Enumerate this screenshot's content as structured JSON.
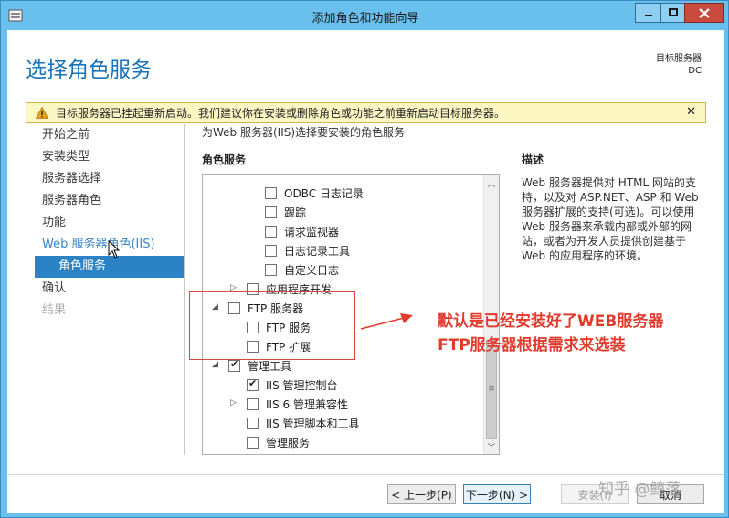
{
  "window": {
    "title": "添加角色和功能向导",
    "min_symbol": "—",
    "max_symbol": "□",
    "close_symbol": "✕"
  },
  "header": {
    "page_title": "选择角色服务",
    "dest_server_label": "目标服务器",
    "dest_server_name": "DC"
  },
  "warning": {
    "text": "目标服务器已挂起重新启动。我们建议你在安装或删除角色或功能之前重新启动目标服务器。",
    "close_symbol": "✕"
  },
  "nav": [
    {
      "label": "开始之前",
      "state": "normal"
    },
    {
      "label": "安装类型",
      "state": "normal"
    },
    {
      "label": "服务器选择",
      "state": "normal"
    },
    {
      "label": "服务器角色",
      "state": "normal"
    },
    {
      "label": "功能",
      "state": "normal"
    },
    {
      "label": "Web 服务器角色(IIS)",
      "state": "link"
    },
    {
      "label": "角色服务",
      "state": "selected"
    },
    {
      "label": "确认",
      "state": "normal"
    },
    {
      "label": "结果",
      "state": "disabled"
    }
  ],
  "content": {
    "description_top": "为Web 服务器(IIS)选择要安装的角色服务",
    "role_services_header": "角色服务",
    "description_header": "描述",
    "description_body": "Web 服务器提供对 HTML 网站的支持，以及对 ASP.NET、ASP 和 Web 服务器扩展的支持(可选)。可以使用 Web 服务器来承载内部或外部的网站，或者为开发人员提供创建基于 Web 的应用程序的环境。"
  },
  "tree": [
    {
      "label": "ODBC 日志记录",
      "checked": false,
      "expander": ""
    },
    {
      "label": "跟踪",
      "checked": false,
      "expander": ""
    },
    {
      "label": "请求监视器",
      "checked": false,
      "expander": ""
    },
    {
      "label": "日志记录工具",
      "checked": false,
      "expander": ""
    },
    {
      "label": "自定义日志",
      "checked": false,
      "expander": ""
    },
    {
      "label": "应用程序开发",
      "checked": false,
      "expander": "▷"
    },
    {
      "label": "FTP 服务器",
      "checked": false,
      "expander": "◢"
    },
    {
      "label": "FTP 服务",
      "checked": false,
      "expander": ""
    },
    {
      "label": "FTP 扩展",
      "checked": false,
      "expander": ""
    },
    {
      "label": "管理工具",
      "checked": true,
      "expander": "◢"
    },
    {
      "label": "IIS 管理控制台",
      "checked": true,
      "expander": ""
    },
    {
      "label": "IIS 6 管理兼容性",
      "checked": false,
      "expander": "▷"
    },
    {
      "label": "IIS 管理脚本和工具",
      "checked": false,
      "expander": ""
    },
    {
      "label": "管理服务",
      "checked": false,
      "expander": ""
    }
  ],
  "scrollbar": {
    "up_symbol": "︿",
    "down_symbol": "﹀",
    "grip_symbol": "≡"
  },
  "annotation": {
    "line1": "默认是已经安装好了WEB服务器",
    "line2": "FTP服务器根据需求来选装"
  },
  "buttons": {
    "prev": "< 上一步(P)",
    "next": "下一步(N) >",
    "install": "安装(I)",
    "cancel": "取消"
  },
  "watermark": "知乎 @鲸落",
  "colors": {
    "accent": "#2b83c6",
    "title_blue": "#1a73b5",
    "annotation_red": "#e23b2e"
  }
}
